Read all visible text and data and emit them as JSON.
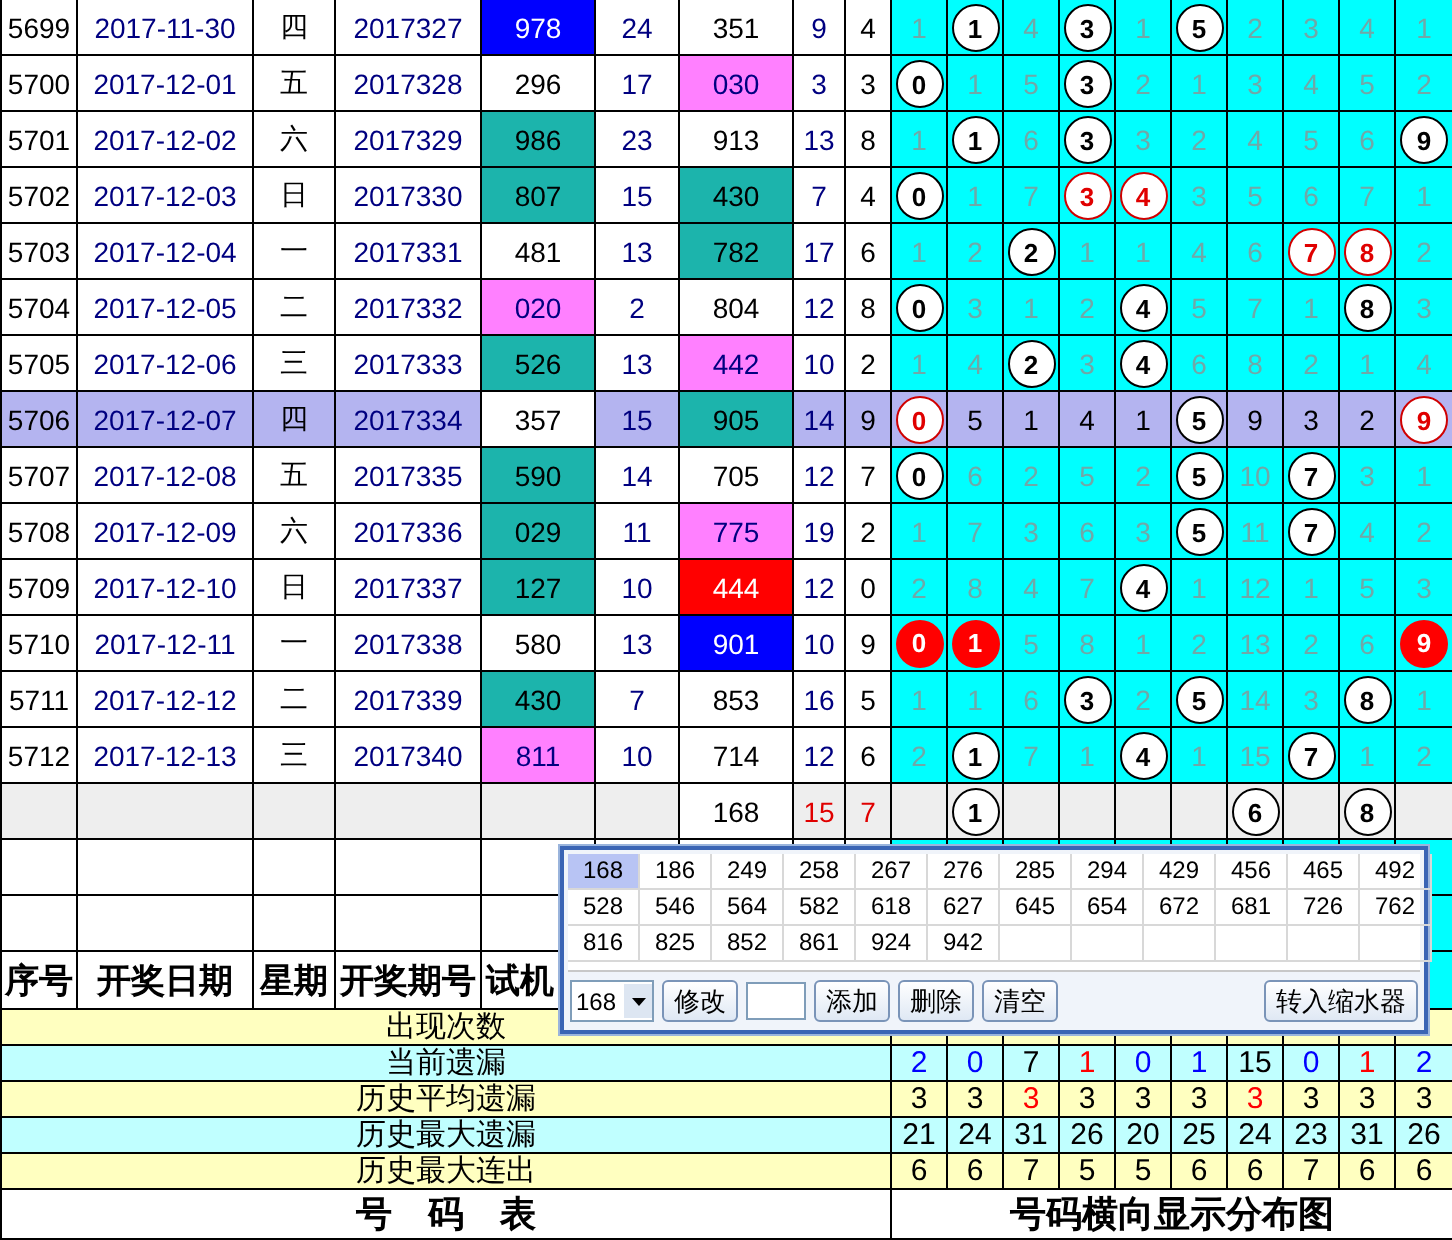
{
  "rows": [
    {
      "seq": "5699",
      "date": "2017-11-30",
      "weekday": "四",
      "period": "2017327",
      "test": {
        "value": "978",
        "color": "#0000ff"
      },
      "col6": "24",
      "open": {
        "value": "351"
      },
      "sum": "9",
      "span": "4",
      "highlighted": false,
      "dist": [
        {
          "kind": "miss",
          "text": "1"
        },
        {
          "kind": "ball",
          "text": "1"
        },
        {
          "kind": "miss",
          "text": "4"
        },
        {
          "kind": "ball",
          "text": "3"
        },
        {
          "kind": "miss",
          "text": "1"
        },
        {
          "kind": "ball",
          "text": "5"
        },
        {
          "kind": "miss",
          "text": "2"
        },
        {
          "kind": "miss",
          "text": "3"
        },
        {
          "kind": "miss",
          "text": "4"
        },
        {
          "kind": "miss",
          "text": "1"
        }
      ]
    },
    {
      "seq": "5700",
      "date": "2017-12-01",
      "weekday": "五",
      "period": "2017328",
      "test": {
        "value": "296"
      },
      "col6": "17",
      "open": {
        "value": "030",
        "color": "#ff80ff"
      },
      "sum": "3",
      "span": "3",
      "highlighted": false,
      "dist": [
        {
          "kind": "ball",
          "text": "0"
        },
        {
          "kind": "miss",
          "text": "1"
        },
        {
          "kind": "miss",
          "text": "5"
        },
        {
          "kind": "ball",
          "text": "3"
        },
        {
          "kind": "miss",
          "text": "2"
        },
        {
          "kind": "miss",
          "text": "1"
        },
        {
          "kind": "miss",
          "text": "3"
        },
        {
          "kind": "miss",
          "text": "4"
        },
        {
          "kind": "miss",
          "text": "5"
        },
        {
          "kind": "miss",
          "text": "2"
        }
      ]
    },
    {
      "seq": "5701",
      "date": "2017-12-02",
      "weekday": "六",
      "period": "2017329",
      "test": {
        "value": "986",
        "color": "#1cb4ac"
      },
      "col6": "23",
      "open": {
        "value": "913"
      },
      "sum": "13",
      "span": "8",
      "highlighted": false,
      "dist": [
        {
          "kind": "miss",
          "text": "1"
        },
        {
          "kind": "ball",
          "text": "1"
        },
        {
          "kind": "miss",
          "text": "6"
        },
        {
          "kind": "ball",
          "text": "3"
        },
        {
          "kind": "miss",
          "text": "3"
        },
        {
          "kind": "miss",
          "text": "2"
        },
        {
          "kind": "miss",
          "text": "4"
        },
        {
          "kind": "miss",
          "text": "5"
        },
        {
          "kind": "miss",
          "text": "6"
        },
        {
          "kind": "ball",
          "text": "9"
        }
      ]
    },
    {
      "seq": "5702",
      "date": "2017-12-03",
      "weekday": "日",
      "period": "2017330",
      "test": {
        "value": "807",
        "color": "#1cb4ac"
      },
      "col6": "15",
      "open": {
        "value": "430",
        "color": "#1cb4ac"
      },
      "sum": "7",
      "span": "4",
      "highlighted": false,
      "dist": [
        {
          "kind": "ball",
          "text": "0"
        },
        {
          "kind": "miss",
          "text": "1"
        },
        {
          "kind": "miss",
          "text": "7"
        },
        {
          "kind": "ball-red",
          "text": "3"
        },
        {
          "kind": "ball-red",
          "text": "4"
        },
        {
          "kind": "miss",
          "text": "3"
        },
        {
          "kind": "miss",
          "text": "5"
        },
        {
          "kind": "miss",
          "text": "6"
        },
        {
          "kind": "miss",
          "text": "7"
        },
        {
          "kind": "miss",
          "text": "1"
        }
      ]
    },
    {
      "seq": "5703",
      "date": "2017-12-04",
      "weekday": "一",
      "period": "2017331",
      "test": {
        "value": "481"
      },
      "col6": "13",
      "open": {
        "value": "782",
        "color": "#1cb4ac"
      },
      "sum": "17",
      "span": "6",
      "highlighted": false,
      "dist": [
        {
          "kind": "miss",
          "text": "1"
        },
        {
          "kind": "miss",
          "text": "2"
        },
        {
          "kind": "ball",
          "text": "2"
        },
        {
          "kind": "miss",
          "text": "1"
        },
        {
          "kind": "miss",
          "text": "1"
        },
        {
          "kind": "miss",
          "text": "4"
        },
        {
          "kind": "miss",
          "text": "6"
        },
        {
          "kind": "ball-red",
          "text": "7"
        },
        {
          "kind": "ball-red",
          "text": "8"
        },
        {
          "kind": "miss",
          "text": "2"
        }
      ]
    },
    {
      "seq": "5704",
      "date": "2017-12-05",
      "weekday": "二",
      "period": "2017332",
      "test": {
        "value": "020",
        "color": "#ff80ff"
      },
      "col6": "2",
      "open": {
        "value": "804"
      },
      "sum": "12",
      "span": "8",
      "highlighted": false,
      "dist": [
        {
          "kind": "ball",
          "text": "0"
        },
        {
          "kind": "miss",
          "text": "3"
        },
        {
          "kind": "miss",
          "text": "1"
        },
        {
          "kind": "miss",
          "text": "2"
        },
        {
          "kind": "ball",
          "text": "4"
        },
        {
          "kind": "miss",
          "text": "5"
        },
        {
          "kind": "miss",
          "text": "7"
        },
        {
          "kind": "miss",
          "text": "1"
        },
        {
          "kind": "ball",
          "text": "8"
        },
        {
          "kind": "miss",
          "text": "3"
        }
      ]
    },
    {
      "seq": "5705",
      "date": "2017-12-06",
      "weekday": "三",
      "period": "2017333",
      "test": {
        "value": "526",
        "color": "#1cb4ac"
      },
      "col6": "13",
      "open": {
        "value": "442",
        "color": "#ff80ff"
      },
      "sum": "10",
      "span": "2",
      "highlighted": false,
      "dist": [
        {
          "kind": "miss",
          "text": "1"
        },
        {
          "kind": "miss",
          "text": "4"
        },
        {
          "kind": "ball",
          "text": "2"
        },
        {
          "kind": "miss",
          "text": "3"
        },
        {
          "kind": "ball",
          "text": "4"
        },
        {
          "kind": "miss",
          "text": "6"
        },
        {
          "kind": "miss",
          "text": "8"
        },
        {
          "kind": "miss",
          "text": "2"
        },
        {
          "kind": "miss",
          "text": "1"
        },
        {
          "kind": "miss",
          "text": "4"
        }
      ]
    },
    {
      "seq": "5706",
      "date": "2017-12-07",
      "weekday": "四",
      "period": "2017334",
      "test": {
        "value": "357"
      },
      "col6": "15",
      "open": {
        "value": "905",
        "color": "#1cb4ac"
      },
      "sum": "14",
      "span": "9",
      "highlighted": true,
      "dist": [
        {
          "kind": "ball-red",
          "text": "0"
        },
        {
          "kind": "miss",
          "text": "5"
        },
        {
          "kind": "miss",
          "text": "1"
        },
        {
          "kind": "miss",
          "text": "4"
        },
        {
          "kind": "miss",
          "text": "1"
        },
        {
          "kind": "ball",
          "text": "5"
        },
        {
          "kind": "miss",
          "text": "9"
        },
        {
          "kind": "miss",
          "text": "3"
        },
        {
          "kind": "miss",
          "text": "2"
        },
        {
          "kind": "ball-red",
          "text": "9"
        }
      ]
    },
    {
      "seq": "5707",
      "date": "2017-12-08",
      "weekday": "五",
      "period": "2017335",
      "test": {
        "value": "590",
        "color": "#1cb4ac"
      },
      "col6": "14",
      "open": {
        "value": "705"
      },
      "sum": "12",
      "span": "7",
      "highlighted": false,
      "dist": [
        {
          "kind": "ball",
          "text": "0"
        },
        {
          "kind": "miss",
          "text": "6"
        },
        {
          "kind": "miss",
          "text": "2"
        },
        {
          "kind": "miss",
          "text": "5"
        },
        {
          "kind": "miss",
          "text": "2"
        },
        {
          "kind": "ball",
          "text": "5"
        },
        {
          "kind": "miss",
          "text": "10"
        },
        {
          "kind": "ball",
          "text": "7"
        },
        {
          "kind": "miss",
          "text": "3"
        },
        {
          "kind": "miss",
          "text": "1"
        }
      ]
    },
    {
      "seq": "5708",
      "date": "2017-12-09",
      "weekday": "六",
      "period": "2017336",
      "test": {
        "value": "029",
        "color": "#1cb4ac"
      },
      "col6": "11",
      "open": {
        "value": "775",
        "color": "#ff80ff"
      },
      "sum": "19",
      "span": "2",
      "highlighted": false,
      "dist": [
        {
          "kind": "miss",
          "text": "1"
        },
        {
          "kind": "miss",
          "text": "7"
        },
        {
          "kind": "miss",
          "text": "3"
        },
        {
          "kind": "miss",
          "text": "6"
        },
        {
          "kind": "miss",
          "text": "3"
        },
        {
          "kind": "ball",
          "text": "5"
        },
        {
          "kind": "miss",
          "text": "11"
        },
        {
          "kind": "ball",
          "text": "7"
        },
        {
          "kind": "miss",
          "text": "4"
        },
        {
          "kind": "miss",
          "text": "2"
        }
      ]
    },
    {
      "seq": "5709",
      "date": "2017-12-10",
      "weekday": "日",
      "period": "2017337",
      "test": {
        "value": "127",
        "color": "#1cb4ac"
      },
      "col6": "10",
      "open": {
        "value": "444",
        "color": "#ff0000"
      },
      "sum": "12",
      "span": "0",
      "highlighted": false,
      "dist": [
        {
          "kind": "miss",
          "text": "2"
        },
        {
          "kind": "miss",
          "text": "8"
        },
        {
          "kind": "miss",
          "text": "4"
        },
        {
          "kind": "miss",
          "text": "7"
        },
        {
          "kind": "ball",
          "text": "4"
        },
        {
          "kind": "miss",
          "text": "1"
        },
        {
          "kind": "miss",
          "text": "12"
        },
        {
          "kind": "miss",
          "text": "1"
        },
        {
          "kind": "miss",
          "text": "5"
        },
        {
          "kind": "miss",
          "text": "3"
        }
      ]
    },
    {
      "seq": "5710",
      "date": "2017-12-11",
      "weekday": "一",
      "period": "2017338",
      "test": {
        "value": "580"
      },
      "col6": "13",
      "open": {
        "value": "901",
        "color": "#0000ff"
      },
      "sum": "10",
      "span": "9",
      "highlighted": false,
      "dist": [
        {
          "kind": "ball-filled",
          "text": "0"
        },
        {
          "kind": "ball-filled",
          "text": "1"
        },
        {
          "kind": "miss",
          "text": "5"
        },
        {
          "kind": "miss",
          "text": "8"
        },
        {
          "kind": "miss",
          "text": "1"
        },
        {
          "kind": "miss",
          "text": "2"
        },
        {
          "kind": "miss",
          "text": "13"
        },
        {
          "kind": "miss",
          "text": "2"
        },
        {
          "kind": "miss",
          "text": "6"
        },
        {
          "kind": "ball-filled",
          "text": "9"
        }
      ]
    },
    {
      "seq": "5711",
      "date": "2017-12-12",
      "weekday": "二",
      "period": "2017339",
      "test": {
        "value": "430",
        "color": "#1cb4ac"
      },
      "col6": "7",
      "open": {
        "value": "853"
      },
      "sum": "16",
      "span": "5",
      "highlighted": false,
      "dist": [
        {
          "kind": "miss",
          "text": "1"
        },
        {
          "kind": "miss",
          "text": "1"
        },
        {
          "kind": "miss",
          "text": "6"
        },
        {
          "kind": "ball",
          "text": "3"
        },
        {
          "kind": "miss",
          "text": "2"
        },
        {
          "kind": "ball",
          "text": "5"
        },
        {
          "kind": "miss",
          "text": "14"
        },
        {
          "kind": "miss",
          "text": "3"
        },
        {
          "kind": "ball",
          "text": "8"
        },
        {
          "kind": "miss",
          "text": "1"
        }
      ]
    },
    {
      "seq": "5712",
      "date": "2017-12-13",
      "weekday": "三",
      "period": "2017340",
      "test": {
        "value": "811",
        "color": "#ff80ff"
      },
      "col6": "10",
      "open": {
        "value": "714"
      },
      "sum": "12",
      "span": "6",
      "highlighted": false,
      "dist": [
        {
          "kind": "miss",
          "text": "2"
        },
        {
          "kind": "ball",
          "text": "1"
        },
        {
          "kind": "miss",
          "text": "7"
        },
        {
          "kind": "miss",
          "text": "1"
        },
        {
          "kind": "ball",
          "text": "4"
        },
        {
          "kind": "miss",
          "text": "1"
        },
        {
          "kind": "miss",
          "text": "15"
        },
        {
          "kind": "ball",
          "text": "7"
        },
        {
          "kind": "miss",
          "text": "1"
        },
        {
          "kind": "miss",
          "text": "2"
        }
      ]
    }
  ],
  "summary_row": {
    "open": "168",
    "sum": "15",
    "span": "7",
    "dist": [
      {
        "kind": "empty"
      },
      {
        "kind": "ball",
        "text": "1"
      },
      {
        "kind": "empty"
      },
      {
        "kind": "empty"
      },
      {
        "kind": "empty"
      },
      {
        "kind": "empty"
      },
      {
        "kind": "ball",
        "text": "6"
      },
      {
        "kind": "empty"
      },
      {
        "kind": "ball",
        "text": "8"
      },
      {
        "kind": "empty"
      }
    ]
  },
  "header": [
    "序号",
    "开奖日期",
    "星期",
    "开奖期号",
    "试机"
  ],
  "stats": [
    {
      "label": "出现次数"
    },
    {
      "label": "当前遗漏",
      "values": [
        {
          "text": "2",
          "color": "#0000ff"
        },
        {
          "text": "0",
          "color": "#0000ff"
        },
        {
          "text": "7",
          "color": "#000000"
        },
        {
          "text": "1",
          "color": "#ff0000"
        },
        {
          "text": "0",
          "color": "#0000ff"
        },
        {
          "text": "1",
          "color": "#0000ff"
        },
        {
          "text": "15",
          "color": "#000000"
        },
        {
          "text": "0",
          "color": "#0000ff"
        },
        {
          "text": "1",
          "color": "#ff0000"
        },
        {
          "text": "2",
          "color": "#0000ff"
        }
      ]
    },
    {
      "label": "历史平均遗漏",
      "values": [
        {
          "text": "3",
          "color": "#000000"
        },
        {
          "text": "3",
          "color": "#000000"
        },
        {
          "text": "3",
          "color": "#ff0000"
        },
        {
          "text": "3",
          "color": "#000000"
        },
        {
          "text": "3",
          "color": "#000000"
        },
        {
          "text": "3",
          "color": "#000000"
        },
        {
          "text": "3",
          "color": "#ff0000"
        },
        {
          "text": "3",
          "color": "#000000"
        },
        {
          "text": "3",
          "color": "#000000"
        },
        {
          "text": "3",
          "color": "#000000"
        }
      ]
    },
    {
      "label": "历史最大遗漏",
      "values": [
        {
          "text": "21",
          "color": "#000000"
        },
        {
          "text": "24",
          "color": "#000000"
        },
        {
          "text": "31",
          "color": "#000000"
        },
        {
          "text": "26",
          "color": "#000000"
        },
        {
          "text": "20",
          "color": "#000000"
        },
        {
          "text": "25",
          "color": "#000000"
        },
        {
          "text": "24",
          "color": "#000000"
        },
        {
          "text": "23",
          "color": "#000000"
        },
        {
          "text": "31",
          "color": "#000000"
        },
        {
          "text": "26",
          "color": "#000000"
        }
      ]
    },
    {
      "label": "历史最大连出",
      "values": [
        {
          "text": "6",
          "color": "#000000"
        },
        {
          "text": "6",
          "color": "#000000"
        },
        {
          "text": "7",
          "color": "#000000"
        },
        {
          "text": "5",
          "color": "#000000"
        },
        {
          "text": "5",
          "color": "#000000"
        },
        {
          "text": "6",
          "color": "#000000"
        },
        {
          "text": "6",
          "color": "#000000"
        },
        {
          "text": "7",
          "color": "#000000"
        },
        {
          "text": "6",
          "color": "#000000"
        },
        {
          "text": "6",
          "color": "#000000"
        }
      ]
    }
  ],
  "footer": {
    "table_title": "号　码　表",
    "chart_title": "号码横向显示分布图"
  },
  "popup": {
    "items": [
      {
        "text": "168",
        "selected": true
      },
      {
        "text": "186",
        "selected": false
      },
      {
        "text": "249",
        "selected": false
      },
      {
        "text": "258",
        "selected": false
      },
      {
        "text": "267",
        "selected": false
      },
      {
        "text": "276",
        "selected": false
      },
      {
        "text": "285",
        "selected": false
      },
      {
        "text": "294",
        "selected": false
      },
      {
        "text": "429",
        "selected": false
      },
      {
        "text": "456",
        "selected": false
      },
      {
        "text": "465",
        "selected": false
      },
      {
        "text": "492",
        "selected": false
      },
      {
        "text": "528",
        "selected": false
      },
      {
        "text": "546",
        "selected": false
      },
      {
        "text": "564",
        "selected": false
      },
      {
        "text": "582",
        "selected": false
      },
      {
        "text": "618",
        "selected": false
      },
      {
        "text": "627",
        "selected": false
      },
      {
        "text": "645",
        "selected": false
      },
      {
        "text": "654",
        "selected": false
      },
      {
        "text": "672",
        "selected": false
      },
      {
        "text": "681",
        "selected": false
      },
      {
        "text": "726",
        "selected": false
      },
      {
        "text": "762",
        "selected": false
      },
      {
        "text": "816",
        "selected": false
      },
      {
        "text": "825",
        "selected": false
      },
      {
        "text": "852",
        "selected": false
      },
      {
        "text": "861",
        "selected": false
      },
      {
        "text": "924",
        "selected": false
      },
      {
        "text": "942",
        "selected": false
      }
    ],
    "combo": "168",
    "buttons": [
      "修改",
      "添加",
      "删除",
      "清空",
      "转入缩水器"
    ]
  }
}
